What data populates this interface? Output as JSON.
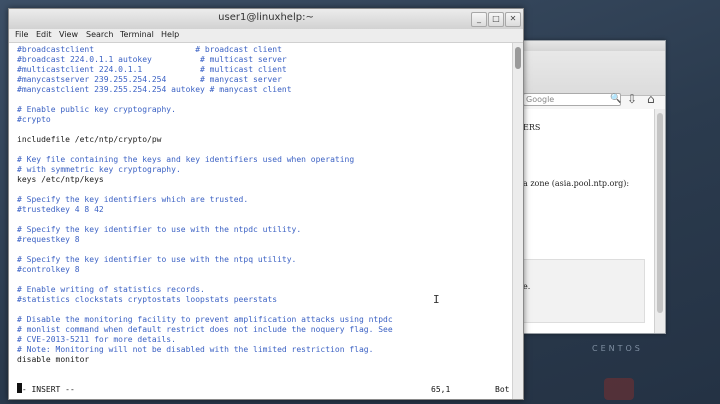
{
  "terminal": {
    "title": "user1@linuxhelp:~",
    "window_buttons": [
      "_",
      "□",
      "✕"
    ],
    "menu": [
      "File",
      "Edit",
      "View",
      "Search",
      "Terminal",
      "Help"
    ],
    "lines": [
      {
        "text": "#broadcastclient                     # broadcast client",
        "comment": true
      },
      {
        "text": "#broadcast 224.0.1.1 autokey          # multicast server",
        "comment": true
      },
      {
        "text": "#multicastclient 224.0.1.1            # multicast client",
        "comment": true
      },
      {
        "text": "#manycastserver 239.255.254.254       # manycast server",
        "comment": true
      },
      {
        "text": "#manycastclient 239.255.254.254 autokey # manycast client",
        "comment": true
      },
      {
        "text": "",
        "comment": false
      },
      {
        "text": "# Enable public key cryptography.",
        "comment": true
      },
      {
        "text": "#crypto",
        "comment": true
      },
      {
        "text": "",
        "comment": false
      },
      {
        "text": "includefile /etc/ntp/crypto/pw",
        "comment": false
      },
      {
        "text": "",
        "comment": false
      },
      {
        "text": "# Key file containing the keys and key identifiers used when operating",
        "comment": true
      },
      {
        "text": "# with symmetric key cryptography.",
        "comment": true
      },
      {
        "text": "keys /etc/ntp/keys",
        "comment": false
      },
      {
        "text": "",
        "comment": false
      },
      {
        "text": "# Specify the key identifiers which are trusted.",
        "comment": true
      },
      {
        "text": "#trustedkey 4 8 42",
        "comment": true
      },
      {
        "text": "",
        "comment": false
      },
      {
        "text": "# Specify the key identifier to use with the ntpdc utility.",
        "comment": true
      },
      {
        "text": "#requestkey 8",
        "comment": true
      },
      {
        "text": "",
        "comment": false
      },
      {
        "text": "# Specify the key identifier to use with the ntpq utility.",
        "comment": true
      },
      {
        "text": "#controlkey 8",
        "comment": true
      },
      {
        "text": "",
        "comment": false
      },
      {
        "text": "# Enable writing of statistics records.",
        "comment": true
      },
      {
        "text": "#statistics clockstats cryptostats loopstats peerstats",
        "comment": true
      },
      {
        "text": "",
        "comment": false
      },
      {
        "text": "# Disable the monitoring facility to prevent amplification attacks using ntpdc",
        "comment": true
      },
      {
        "text": "# monlist command when default restrict does not include the noquery flag. See",
        "comment": true
      },
      {
        "text": "# CVE-2013-5211 for more details.",
        "comment": true
      },
      {
        "text": "# Note: Monitoring will not be disabled with the limited restriction flag.",
        "comment": true
      },
      {
        "text": "disable monitor",
        "comment": false
      }
    ],
    "status": {
      "mode": "-- INSERT --",
      "position": "65,1",
      "scroll": "Bot"
    }
  },
  "browser": {
    "search_placeholder": "Google",
    "fragment_heading": "ERS",
    "fragment_zone": "a zone (asia.pool.ntp.org):",
    "fragment_e": "e."
  },
  "desktop": {
    "brand": "CENTOS"
  },
  "colors": {
    "comment": "#3c62c4",
    "code": "#1a1a1a",
    "desktop": "#2b3b4e"
  }
}
